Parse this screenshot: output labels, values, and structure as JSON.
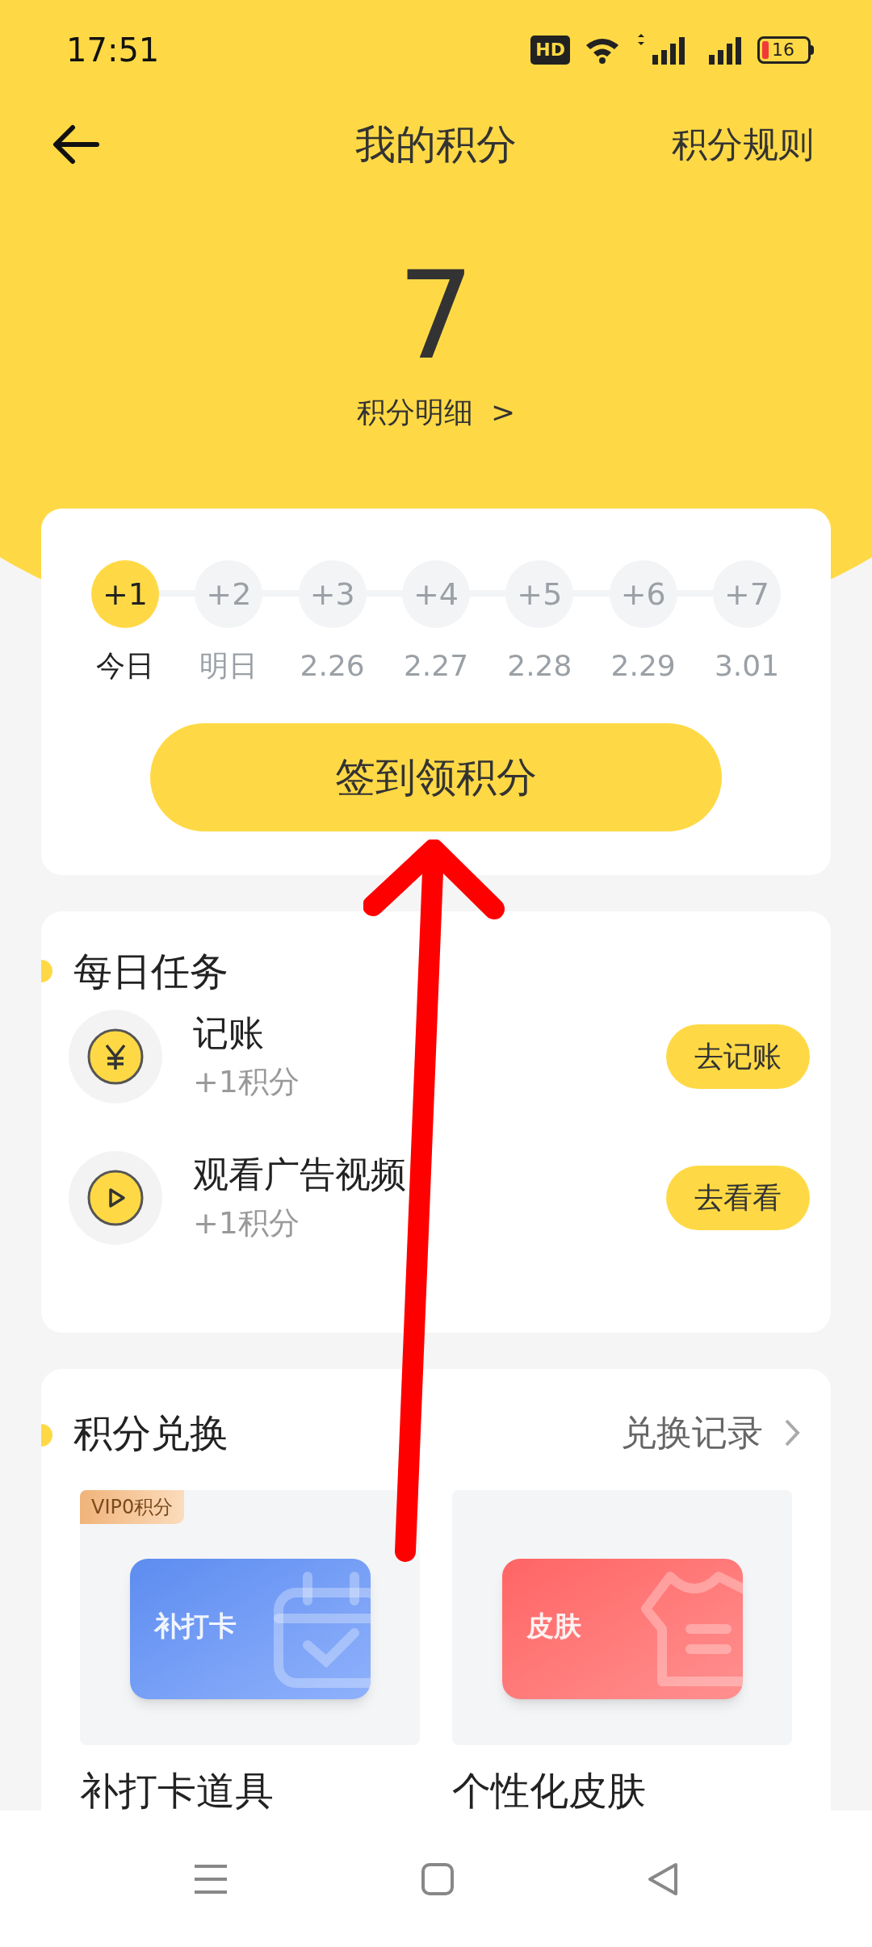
{
  "status_bar": {
    "time": "17:51",
    "hd_badge": "HD",
    "battery": "16"
  },
  "header": {
    "title": "我的积分",
    "action": "积分规则"
  },
  "points": {
    "value": "7",
    "detail_link": "积分明细",
    "detail_arrow": ">"
  },
  "checkin": {
    "steps": [
      {
        "reward": "+1",
        "day": "今日",
        "selected": true
      },
      {
        "reward": "+2",
        "day": "明日",
        "selected": false
      },
      {
        "reward": "+3",
        "day": "2.26",
        "selected": false
      },
      {
        "reward": "+4",
        "day": "2.27",
        "selected": false
      },
      {
        "reward": "+5",
        "day": "2.28",
        "selected": false
      },
      {
        "reward": "+6",
        "day": "2.29",
        "selected": false
      },
      {
        "reward": "+7",
        "day": "3.01",
        "selected": false
      }
    ],
    "button": "签到领积分"
  },
  "daily_tasks": {
    "title": "每日任务",
    "tasks": [
      {
        "kind": "yuan",
        "title": "记账",
        "reward": "+1积分",
        "button": "去记账"
      },
      {
        "kind": "play",
        "title": "观看广告视频",
        "reward": "+1积分",
        "button": "去看看"
      }
    ]
  },
  "exchange": {
    "title": "积分兑换",
    "link": "兑换记录",
    "items": [
      {
        "kind": "calendar",
        "badge": "VIP0积分",
        "card_text": "补打卡",
        "label": "补打卡道具"
      },
      {
        "kind": "shirt",
        "card_text": "皮肤",
        "label": "个性化皮肤"
      }
    ]
  }
}
